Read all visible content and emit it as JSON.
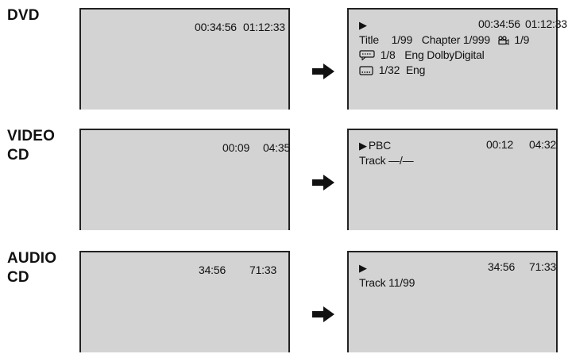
{
  "dvd": {
    "label": "DVD",
    "before": {
      "elapsed": "00:34:56",
      "total": "01:12:33"
    },
    "after": {
      "elapsed": "00:34:56",
      "total": "01:12:33",
      "title_label": "Title",
      "title_value": "1/99",
      "chapter_label": "Chapter",
      "chapter_value": "1/999",
      "angle_value": "1/9",
      "audio_value": "1/8",
      "audio_lang": "Eng",
      "audio_format": "DolbyDigital",
      "subtitle_value": "1/32",
      "subtitle_lang": "Eng"
    }
  },
  "vcd": {
    "label": "VIDEO\nCD",
    "before": {
      "elapsed": "00:09",
      "total": "04:35"
    },
    "after": {
      "mode": "PBC",
      "elapsed": "00:12",
      "total": "04:32",
      "track_text": "Track —/—"
    }
  },
  "acd": {
    "label": "AUDIO\nCD",
    "before": {
      "elapsed": "34:56",
      "total": "71:33"
    },
    "after": {
      "elapsed": "34:56",
      "total": "71:33",
      "track_text": "Track 11/99"
    }
  },
  "icons": {
    "play": "play-icon",
    "arrow": "right-arrow-icon",
    "angle": "camera-angle-icon",
    "audio": "speech-bubble-icon",
    "subtitle": "subtitle-box-icon"
  }
}
